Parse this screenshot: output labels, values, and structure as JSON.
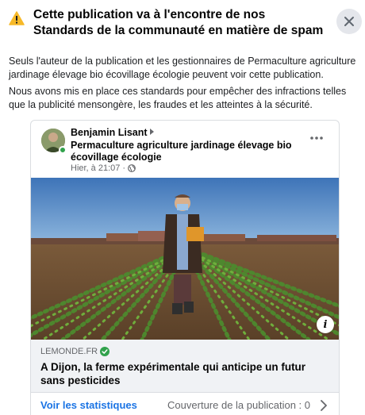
{
  "header": {
    "title": "Cette publication va à l'encontre de nos Standards de la communauté en matière de spam",
    "warning_icon": "warning-triangle-icon",
    "close_icon": "close-icon"
  },
  "body": {
    "paragraph1": "Seuls l'auteur de la publication et les gestionnaires de Permaculture agriculture jardinage élevage bio écovillage écologie peuvent voir cette publication.",
    "paragraph2": "Nous avons mis en place ces standards pour empêcher des infractions telles que la publicité mensongère, les fraudes et les atteintes à la sécurité."
  },
  "post": {
    "author": "Benjamin Lisant",
    "group": "Permaculture agriculture jardinage élevage bio écovillage écologie",
    "time": "Hier, à 21:07",
    "privacy_separator": "·",
    "link": {
      "domain": "LEMONDE.FR",
      "title": "A Dijon, la ferme expérimentale qui anticipe un futur sans pesticides"
    },
    "stats_label": "Voir les statistiques",
    "coverage_label": "Couverture de la publication : 0"
  },
  "colors": {
    "warning": "#f7b928",
    "link_blue": "#1b74e4",
    "verified": "#31a24c"
  }
}
